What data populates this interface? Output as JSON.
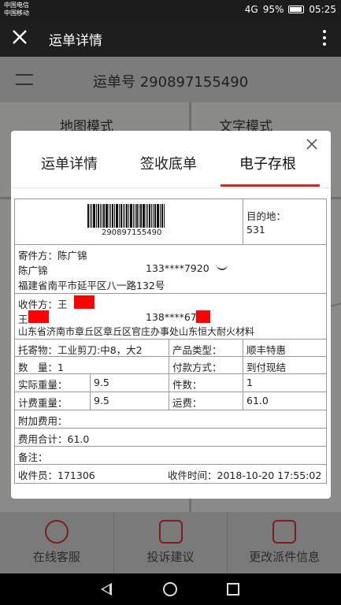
{
  "status_bar": {
    "carrier1": "中国电信",
    "carrier2": "中国移动",
    "network": "4G",
    "battery": "95%",
    "time": "05:25"
  },
  "app_bar": {
    "title": "运单详情"
  },
  "background": {
    "waybill_label": "运单号 290897155490",
    "tab_map": "地图模式",
    "tab_text": "文字模式",
    "bottom_items": [
      "在线客服",
      "投诉建议",
      "更改派件信息"
    ]
  },
  "modal": {
    "tabs": [
      "运单详情",
      "签收底单",
      "电子存根"
    ],
    "active_tab": 2,
    "barcode_number": "290897155490",
    "destination_label": "目的地：",
    "destination_value": "531",
    "sender": {
      "label": "寄件方：",
      "name": "陈广锦",
      "name2": "陈广锦",
      "phone": "133****7920",
      "address": "福建省南平市延平区八一路132号"
    },
    "receiver": {
      "label": "收件方：",
      "name": "王",
      "name2": "王",
      "phone": "138****67",
      "address": "山东省济南市章丘区章丘区官庄办事处山东恒大耐火材料"
    },
    "goods": {
      "label": "托寄物：",
      "value": "工业剪刀:中8，大2",
      "product_type_label": "产品类型：",
      "product_type_value": "顺丰特惠"
    },
    "quantity": {
      "label": "数　量：",
      "value": "1",
      "payment_label": "付款方式：",
      "payment_value": "到付现结"
    },
    "actual_weight": {
      "label": "实际重量：",
      "value": "9.5",
      "pieces_label": "件数：",
      "pieces_value": "1"
    },
    "billed_weight": {
      "label": "计费重量：",
      "value": "9.5",
      "freight_label": "运费：",
      "freight_value": "61.0"
    },
    "extra_fee": {
      "label": "附加费用："
    },
    "total_fee": {
      "label": "费用合计：",
      "value": "61.0"
    },
    "remark": {
      "label": "备注："
    },
    "courier": {
      "label": "收件员：",
      "value": "171306",
      "time_label": "收件时间：",
      "time_value": "2018-10-20 17:55:02"
    }
  }
}
